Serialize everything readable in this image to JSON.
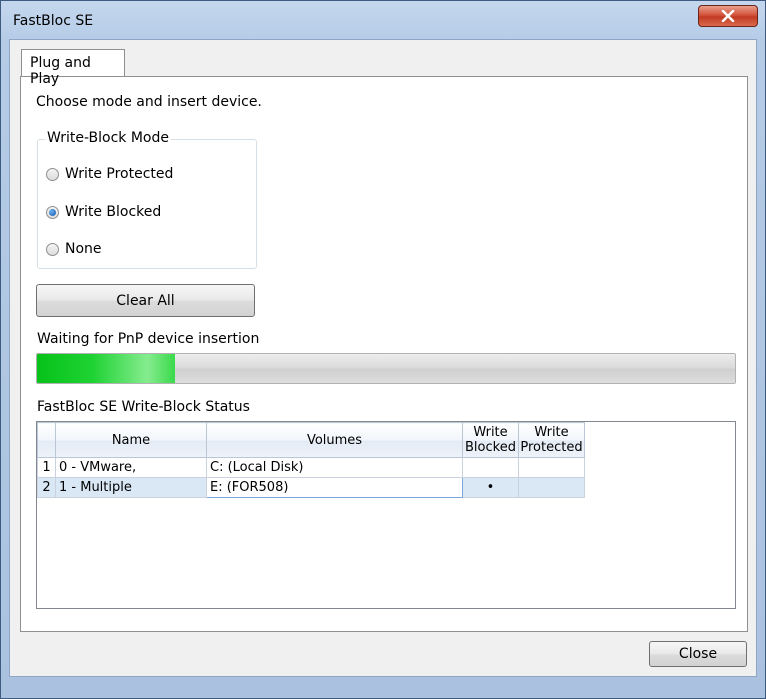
{
  "window": {
    "title": "FastBloc SE",
    "close_icon": "close-icon"
  },
  "tabs": [
    {
      "label": "Plug and Play"
    }
  ],
  "instruction": "Choose mode and insert device.",
  "write_block_mode": {
    "legend": "Write-Block Mode",
    "options": [
      {
        "label": "Write Protected",
        "selected": false
      },
      {
        "label": "Write Blocked",
        "selected": true
      },
      {
        "label": "None",
        "selected": false
      }
    ]
  },
  "clear_all_label": "Clear All",
  "status_text": "Waiting for PnP device insertion",
  "progress_fraction": 0.197,
  "status_table": {
    "label": "FastBloc SE Write-Block Status",
    "columns": [
      "",
      "Name",
      "Volumes",
      "Write\nBlocked",
      "Write\nProtected"
    ],
    "rows": [
      {
        "idx": "1",
        "name": "0 - VMware,",
        "volumes": "C: (Local Disk)",
        "blocked": "",
        "protected": ""
      },
      {
        "idx": "2",
        "name": "1 - Multiple",
        "volumes": "E: (FOR508)",
        "blocked": "•",
        "protected": ""
      }
    ]
  },
  "close_label": "Close"
}
